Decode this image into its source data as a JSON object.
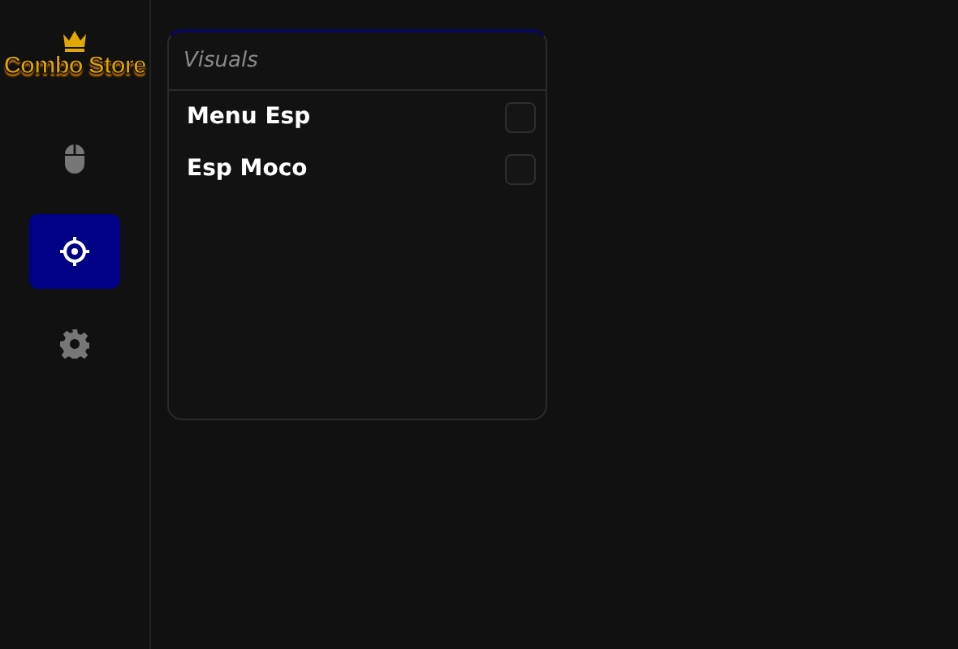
{
  "sidebar": {
    "logo": "Combo Store",
    "items": [
      {
        "kind": "mouse",
        "selected": false
      },
      {
        "kind": "target",
        "selected": true
      },
      {
        "kind": "gear",
        "selected": false
      }
    ]
  },
  "panel": {
    "title": "Visuals",
    "options": [
      {
        "label": "Menu Esp",
        "checked": false
      },
      {
        "label": "Esp Moco",
        "checked": false
      }
    ]
  }
}
